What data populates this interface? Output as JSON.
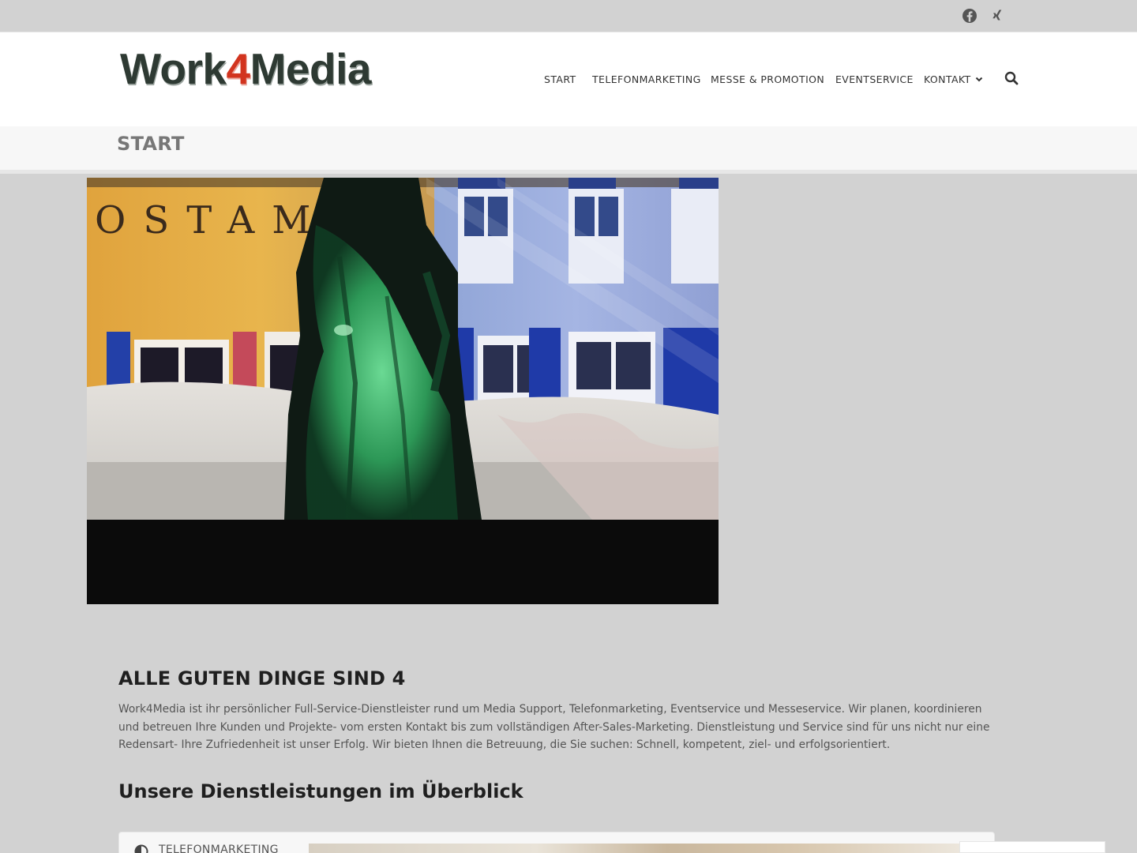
{
  "topbar": {
    "social": [
      {
        "icon": "facebook-icon"
      },
      {
        "icon": "xing-icon"
      }
    ]
  },
  "header": {
    "logo": {
      "part1": "Work",
      "part2": "4",
      "part3": "Media"
    },
    "nav": [
      {
        "label": "START"
      },
      {
        "label": "TELEFONMARKETING"
      },
      {
        "label": "MESSE & PROMOTION"
      },
      {
        "label": "EVENTSERVICE"
      },
      {
        "label": "KONTAKT"
      }
    ],
    "search_icon": "search-icon"
  },
  "page": {
    "title": "START"
  },
  "hero": {
    "icon": "event-photo"
  },
  "content": {
    "heading": "ALLE GUTEN DINGE SIND 4",
    "paragraph": "Work4Media ist ihr persönlicher Full-Service-Dienstleister rund um Media Support, Telefonmarketing, Eventservice und Messeservice. Wir planen, koordinieren und betreuen Ihre Kunden und Projekte- vom ersten Kontakt bis zum vollständigen After-Sales-Marketing. Dienstleistung und Service sind für uns nicht nur eine Redensart- Ihre Zufriedenheit ist unser Erfolg. Wir bieten Ihnen die Betreuung, die Sie suchen: Schnell, kompetent, ziel- und erfolgsorientiert.",
    "subheading": "Unsere Dienstleistungen im Überblick"
  },
  "tabs": [
    {
      "label": "TELEFONMARKETING",
      "icon": "half-circle-icon"
    }
  ]
}
